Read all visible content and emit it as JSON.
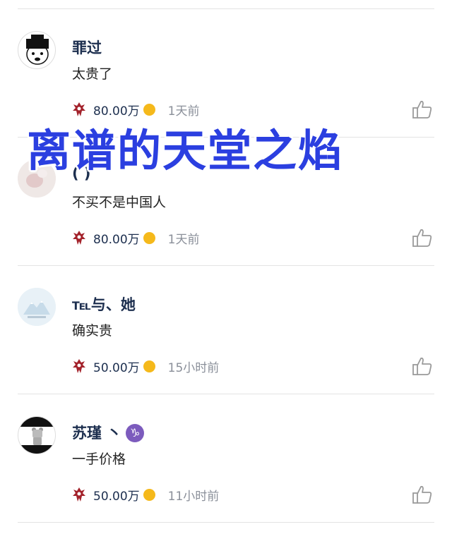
{
  "colors": {
    "name": "#1d2f4f",
    "overlay": "#2b3fe0",
    "coin": "#f5b91b",
    "time": "#8a8f99",
    "horde": "#a3222b"
  },
  "overlay_title": "离谱的天堂之焰",
  "comments": [
    {
      "username": "罪过",
      "text": "太贵了",
      "score": "80.00万",
      "time": "1天前",
      "avatar_icon": "cartoon-face-icon"
    },
    {
      "username": "( )",
      "text": "不买不是中国人",
      "score": "80.00万",
      "time": "1天前",
      "avatar_icon": "blurred-photo-icon"
    },
    {
      "username": "℡与、她",
      "text": "确实贵",
      "score": "50.00万",
      "time": "15小时前",
      "avatar_icon": "mountain-icon"
    },
    {
      "username": "苏瑾 丶",
      "zodiac": "♑",
      "text": "一手价格",
      "score": "50.00万",
      "time": "11小时前",
      "avatar_icon": "bear-figure-icon"
    }
  ]
}
